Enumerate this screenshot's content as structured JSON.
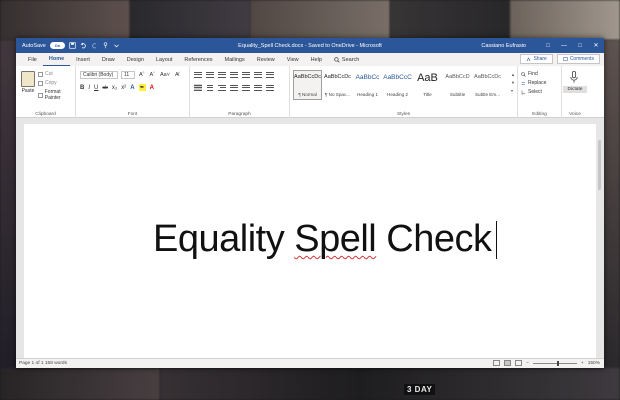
{
  "title_bar": {
    "autosave_label": "AutoSave",
    "autosave_state": "On",
    "document_title": "Equality_Spell Check.docx - Saved to OneDrive - Microsoft",
    "user_name": "Cassiano Eufrasio"
  },
  "tabs": [
    "File",
    "Home",
    "Insert",
    "Draw",
    "Design",
    "Layout",
    "References",
    "Mailings",
    "Review",
    "View",
    "Help"
  ],
  "active_tab": "Home",
  "search_label": "Search",
  "share_label": "Share",
  "comments_label": "Comments",
  "clipboard": {
    "paste": "Paste",
    "cut": "Cut",
    "copy": "Copy",
    "format_painter": "Format Painter",
    "group": "Clipboard"
  },
  "font": {
    "name": "Calibri (Body)",
    "size": "11",
    "group": "Font"
  },
  "paragraph": {
    "group": "Paragraph"
  },
  "styles": {
    "group": "Styles",
    "items": [
      {
        "sample": "AaBbCcDc",
        "name": "¶ Normal"
      },
      {
        "sample": "AaBbCcDc",
        "name": "¶ No Spac..."
      },
      {
        "sample": "AaBbCc",
        "name": "Heading 1"
      },
      {
        "sample": "AaBbCcC",
        "name": "Heading 2"
      },
      {
        "sample": "AaB",
        "name": "Title"
      },
      {
        "sample": "AaBbCcD",
        "name": "Subtitle"
      },
      {
        "sample": "AaBbCcDc",
        "name": "Subtle Em..."
      }
    ]
  },
  "editing": {
    "find": "Find",
    "replace": "Replace",
    "select": "Select",
    "group": "Editing"
  },
  "voice": {
    "dictate": "Dictate",
    "group": "Voice"
  },
  "document": {
    "text_before": "Equality ",
    "misspelled": "Spell",
    "text_after": " Check"
  },
  "status": {
    "page_words": "Page 1 of 1   158 words",
    "zoom": "150%"
  },
  "background_badge": "3 DAY",
  "colors": {
    "ribbon_blue": "#2b579a",
    "spell_error": "#d13438"
  }
}
